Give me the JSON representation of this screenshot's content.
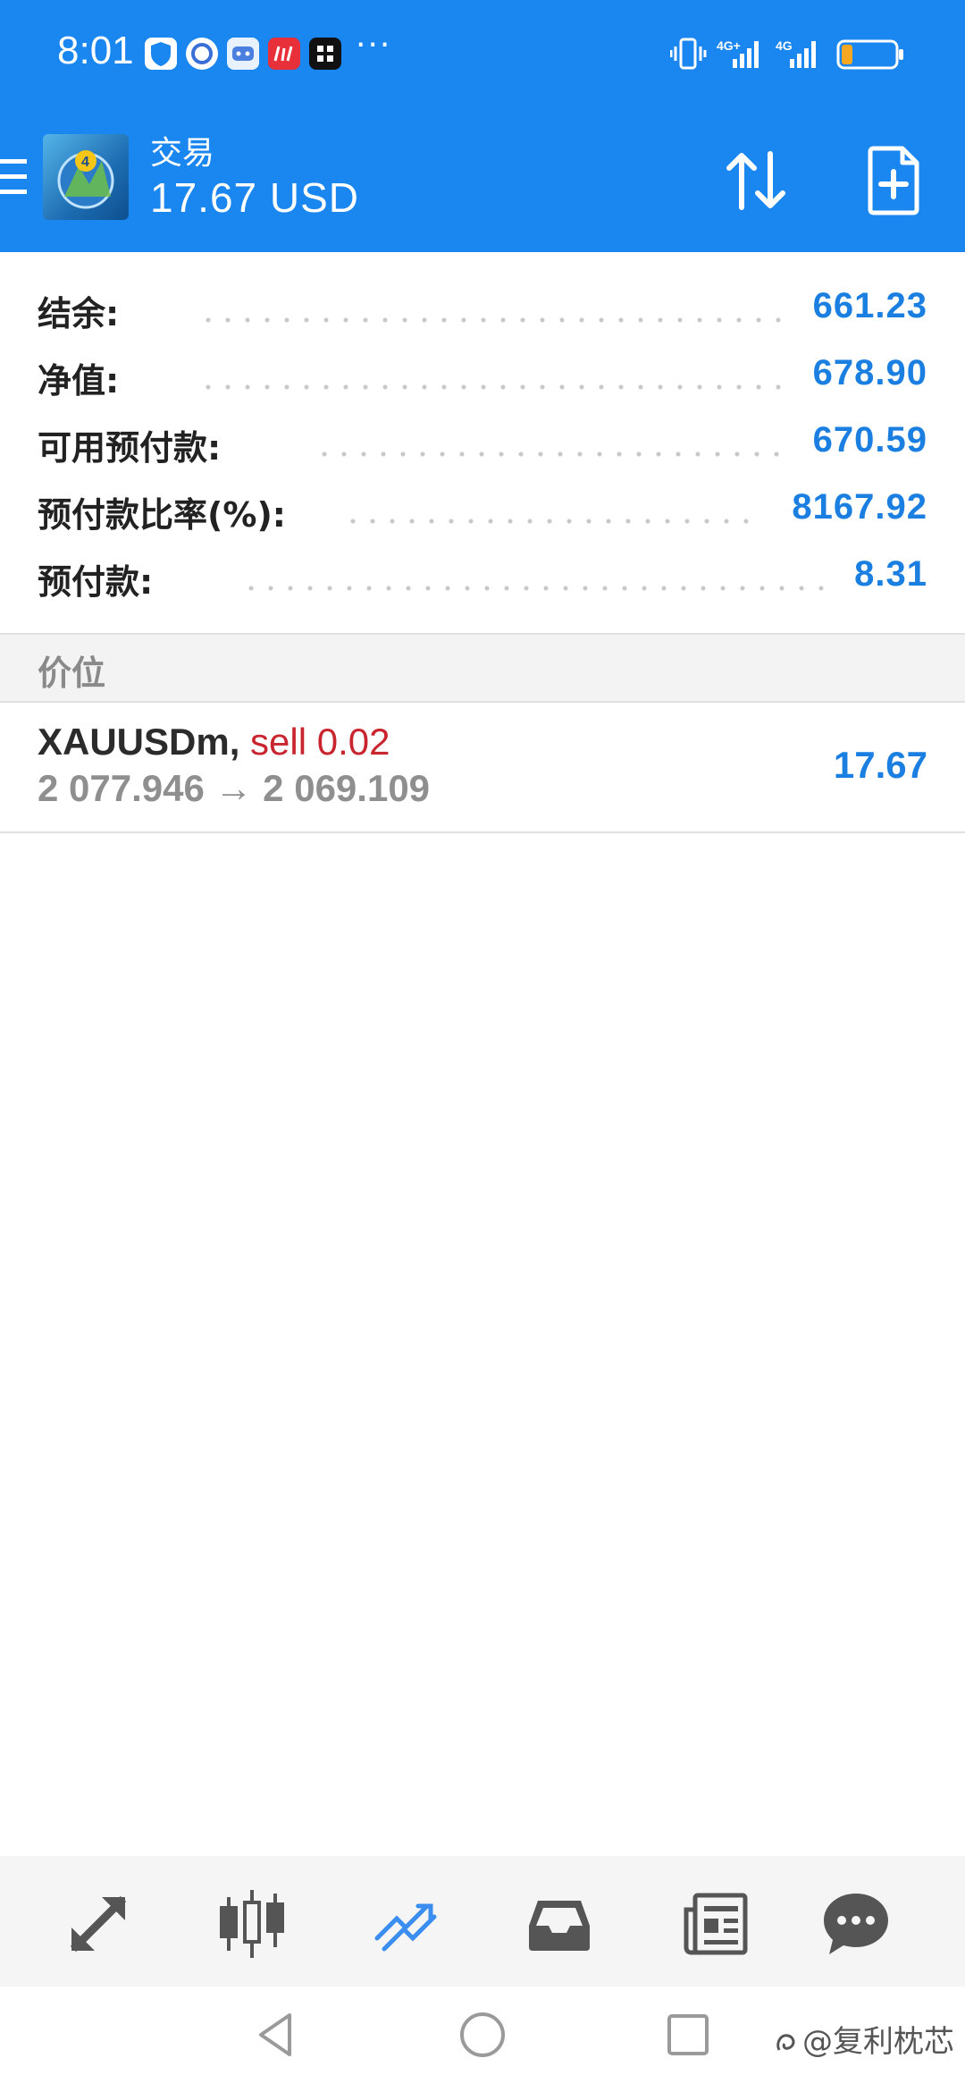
{
  "status_bar": {
    "time": "8:01",
    "more": "···",
    "network_1": "4G+",
    "network_2": "4G"
  },
  "header": {
    "title": "交易",
    "profit_text": "17.67 USD",
    "accent_color": "#1a86f0"
  },
  "summary": [
    {
      "label": "结余:",
      "value": "661.23"
    },
    {
      "label": "净值:",
      "value": "678.90"
    },
    {
      "label": "可用预付款:",
      "value": "670.59"
    },
    {
      "label": "预付款比率(%):",
      "value": "8167.92"
    },
    {
      "label": "预付款:",
      "value": "8.31"
    }
  ],
  "section": {
    "title": "价位"
  },
  "position": {
    "symbol": "XAUUSDm,",
    "side": "sell 0.02",
    "prices": "2 077.946 → 2 069.109",
    "profit": "17.67",
    "side_color": "#c8252f",
    "value_color": "#1a7fe0"
  },
  "bottom_nav": [
    {
      "icon": "quotes-arrows-icon",
      "active": false
    },
    {
      "icon": "candlestick-chart-icon",
      "active": false
    },
    {
      "icon": "trade-trend-icon",
      "active": true
    },
    {
      "icon": "history-inbox-icon",
      "active": false
    },
    {
      "icon": "news-icon",
      "active": false
    },
    {
      "icon": "chat-bubble-icon",
      "active": false
    }
  ],
  "watermark": "@复利枕芯"
}
